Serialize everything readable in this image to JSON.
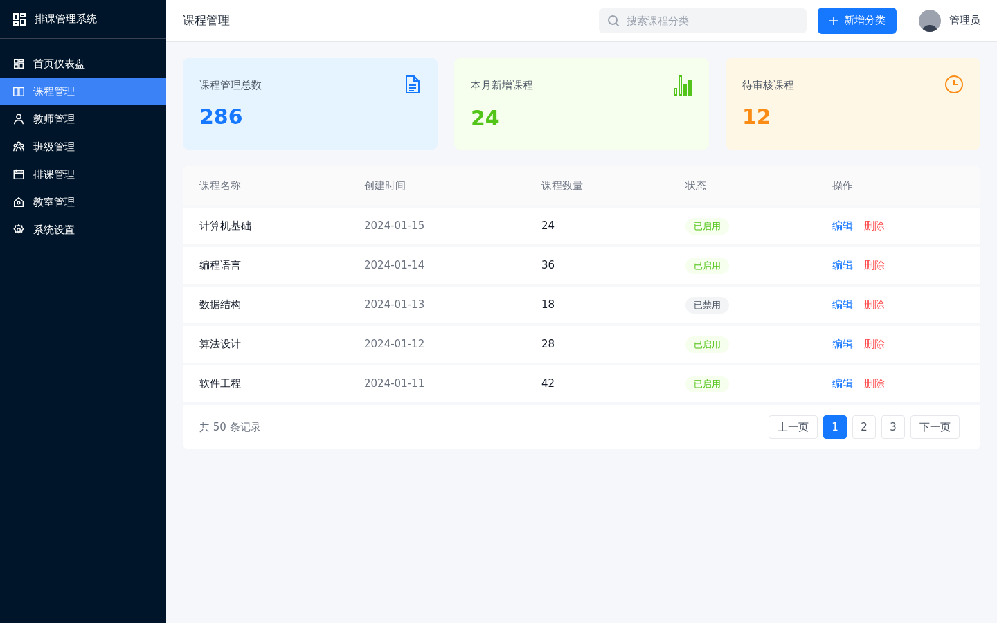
{
  "sidebar": {
    "title": "排课管理系统",
    "items": [
      {
        "label": "首页仪表盘",
        "kind": "grid",
        "selected": false
      },
      {
        "label": "课程管理",
        "kind": "book",
        "selected": true
      },
      {
        "label": "教师管理",
        "kind": "user",
        "selected": false
      },
      {
        "label": "班级管理",
        "kind": "users",
        "selected": false
      },
      {
        "label": "排课管理",
        "kind": "calendar",
        "selected": false
      },
      {
        "label": "教室管理",
        "kind": "home",
        "selected": false
      },
      {
        "label": "系统设置",
        "kind": "gear",
        "selected": false
      }
    ]
  },
  "header": {
    "title": "课程管理",
    "search": {
      "placeholder": "搜索课程分类"
    },
    "add_button": "新增分类",
    "user": "管理员"
  },
  "stats": [
    {
      "kind": "blue",
      "label": "课程管理总数",
      "value": "286"
    },
    {
      "kind": "green",
      "label": "本月新增课程",
      "value": "24"
    },
    {
      "kind": "orange",
      "label": "待审核课程",
      "value": "12"
    }
  ],
  "table": {
    "columns": [
      "课程名称",
      "创建时间",
      "课程数量",
      "状态",
      "操作"
    ],
    "rows": [
      {
        "name": "计算机基础",
        "date": "2024-01-15",
        "count": "24",
        "status": {
          "kind": "enabled",
          "label": "已启用"
        },
        "actions": [
          "编辑",
          "删除"
        ]
      },
      {
        "name": "编程语言",
        "date": "2024-01-14",
        "count": "36",
        "status": {
          "kind": "enabled",
          "label": "已启用"
        },
        "actions": [
          "编辑",
          "删除"
        ]
      },
      {
        "name": "数据结构",
        "date": "2024-01-13",
        "count": "18",
        "status": {
          "kind": "disabled",
          "label": "已禁用"
        },
        "actions": [
          "编辑",
          "删除"
        ]
      },
      {
        "name": "算法设计",
        "date": "2024-01-12",
        "count": "28",
        "status": {
          "kind": "enabled",
          "label": "已启用"
        },
        "actions": [
          "编辑",
          "删除"
        ]
      },
      {
        "name": "软件工程",
        "date": "2024-01-11",
        "count": "42",
        "status": {
          "kind": "enabled",
          "label": "已启用"
        },
        "actions": [
          "编辑",
          "删除"
        ]
      }
    ]
  },
  "pagination": {
    "total": "共 50 条记录",
    "prev": "上一页",
    "pages": [
      {
        "label": "1",
        "selected": true
      },
      {
        "label": "2",
        "selected": false
      },
      {
        "label": "3",
        "selected": false
      }
    ],
    "next": "下一页"
  }
}
